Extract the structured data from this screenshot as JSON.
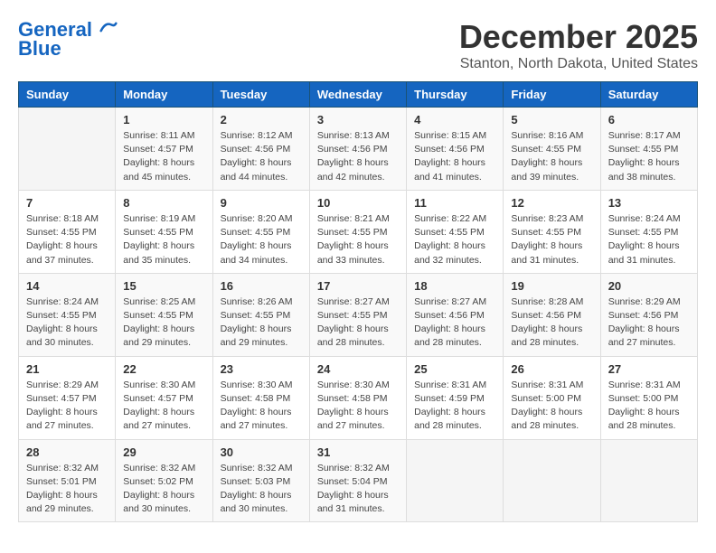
{
  "header": {
    "logo_line1": "General",
    "logo_line2": "Blue",
    "month_title": "December 2025",
    "location": "Stanton, North Dakota, United States"
  },
  "days_of_week": [
    "Sunday",
    "Monday",
    "Tuesday",
    "Wednesday",
    "Thursday",
    "Friday",
    "Saturday"
  ],
  "weeks": [
    [
      {
        "day": "",
        "text": ""
      },
      {
        "day": "1",
        "text": "Sunrise: 8:11 AM\nSunset: 4:57 PM\nDaylight: 8 hours\nand 45 minutes."
      },
      {
        "day": "2",
        "text": "Sunrise: 8:12 AM\nSunset: 4:56 PM\nDaylight: 8 hours\nand 44 minutes."
      },
      {
        "day": "3",
        "text": "Sunrise: 8:13 AM\nSunset: 4:56 PM\nDaylight: 8 hours\nand 42 minutes."
      },
      {
        "day": "4",
        "text": "Sunrise: 8:15 AM\nSunset: 4:56 PM\nDaylight: 8 hours\nand 41 minutes."
      },
      {
        "day": "5",
        "text": "Sunrise: 8:16 AM\nSunset: 4:55 PM\nDaylight: 8 hours\nand 39 minutes."
      },
      {
        "day": "6",
        "text": "Sunrise: 8:17 AM\nSunset: 4:55 PM\nDaylight: 8 hours\nand 38 minutes."
      }
    ],
    [
      {
        "day": "7",
        "text": "Sunrise: 8:18 AM\nSunset: 4:55 PM\nDaylight: 8 hours\nand 37 minutes."
      },
      {
        "day": "8",
        "text": "Sunrise: 8:19 AM\nSunset: 4:55 PM\nDaylight: 8 hours\nand 35 minutes."
      },
      {
        "day": "9",
        "text": "Sunrise: 8:20 AM\nSunset: 4:55 PM\nDaylight: 8 hours\nand 34 minutes."
      },
      {
        "day": "10",
        "text": "Sunrise: 8:21 AM\nSunset: 4:55 PM\nDaylight: 8 hours\nand 33 minutes."
      },
      {
        "day": "11",
        "text": "Sunrise: 8:22 AM\nSunset: 4:55 PM\nDaylight: 8 hours\nand 32 minutes."
      },
      {
        "day": "12",
        "text": "Sunrise: 8:23 AM\nSunset: 4:55 PM\nDaylight: 8 hours\nand 31 minutes."
      },
      {
        "day": "13",
        "text": "Sunrise: 8:24 AM\nSunset: 4:55 PM\nDaylight: 8 hours\nand 31 minutes."
      }
    ],
    [
      {
        "day": "14",
        "text": "Sunrise: 8:24 AM\nSunset: 4:55 PM\nDaylight: 8 hours\nand 30 minutes."
      },
      {
        "day": "15",
        "text": "Sunrise: 8:25 AM\nSunset: 4:55 PM\nDaylight: 8 hours\nand 29 minutes."
      },
      {
        "day": "16",
        "text": "Sunrise: 8:26 AM\nSunset: 4:55 PM\nDaylight: 8 hours\nand 29 minutes."
      },
      {
        "day": "17",
        "text": "Sunrise: 8:27 AM\nSunset: 4:55 PM\nDaylight: 8 hours\nand 28 minutes."
      },
      {
        "day": "18",
        "text": "Sunrise: 8:27 AM\nSunset: 4:56 PM\nDaylight: 8 hours\nand 28 minutes."
      },
      {
        "day": "19",
        "text": "Sunrise: 8:28 AM\nSunset: 4:56 PM\nDaylight: 8 hours\nand 28 minutes."
      },
      {
        "day": "20",
        "text": "Sunrise: 8:29 AM\nSunset: 4:56 PM\nDaylight: 8 hours\nand 27 minutes."
      }
    ],
    [
      {
        "day": "21",
        "text": "Sunrise: 8:29 AM\nSunset: 4:57 PM\nDaylight: 8 hours\nand 27 minutes."
      },
      {
        "day": "22",
        "text": "Sunrise: 8:30 AM\nSunset: 4:57 PM\nDaylight: 8 hours\nand 27 minutes."
      },
      {
        "day": "23",
        "text": "Sunrise: 8:30 AM\nSunset: 4:58 PM\nDaylight: 8 hours\nand 27 minutes."
      },
      {
        "day": "24",
        "text": "Sunrise: 8:30 AM\nSunset: 4:58 PM\nDaylight: 8 hours\nand 27 minutes."
      },
      {
        "day": "25",
        "text": "Sunrise: 8:31 AM\nSunset: 4:59 PM\nDaylight: 8 hours\nand 28 minutes."
      },
      {
        "day": "26",
        "text": "Sunrise: 8:31 AM\nSunset: 5:00 PM\nDaylight: 8 hours\nand 28 minutes."
      },
      {
        "day": "27",
        "text": "Sunrise: 8:31 AM\nSunset: 5:00 PM\nDaylight: 8 hours\nand 28 minutes."
      }
    ],
    [
      {
        "day": "28",
        "text": "Sunrise: 8:32 AM\nSunset: 5:01 PM\nDaylight: 8 hours\nand 29 minutes."
      },
      {
        "day": "29",
        "text": "Sunrise: 8:32 AM\nSunset: 5:02 PM\nDaylight: 8 hours\nand 30 minutes."
      },
      {
        "day": "30",
        "text": "Sunrise: 8:32 AM\nSunset: 5:03 PM\nDaylight: 8 hours\nand 30 minutes."
      },
      {
        "day": "31",
        "text": "Sunrise: 8:32 AM\nSunset: 5:04 PM\nDaylight: 8 hours\nand 31 minutes."
      },
      {
        "day": "",
        "text": ""
      },
      {
        "day": "",
        "text": ""
      },
      {
        "day": "",
        "text": ""
      }
    ]
  ]
}
